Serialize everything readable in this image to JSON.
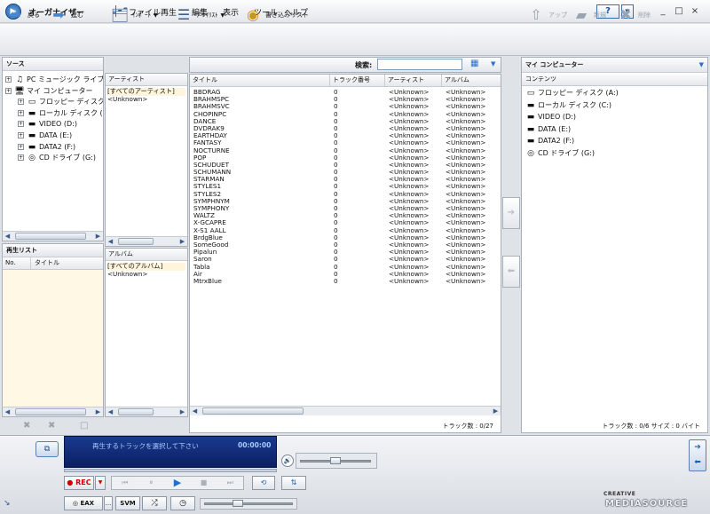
{
  "app": {
    "title": "オーガナイザー"
  },
  "menu": [
    "ファイル",
    "再生",
    "編集",
    "表示",
    "ツール",
    "ヘルプ"
  ],
  "window": {
    "help": "?",
    "min": "_",
    "max": "□",
    "close": "×"
  },
  "toolbar": {
    "back": "戻る",
    "forward": "進む",
    "import": "ｲﾝﾎﾟｰﾄ",
    "playlist": "ﾌﾟﾚｲﾘｽﾄ",
    "burn": "書き込みリスト",
    "up": "アップ",
    "new": "新規",
    "delete": "削除"
  },
  "source": {
    "header": "ソース",
    "items": [
      {
        "label": "PC ミュージック ライブラリ",
        "indent": 0,
        "icon": "music-library-icon",
        "glyph": "♫"
      },
      {
        "label": "マイ コンピューター",
        "indent": 0,
        "icon": "computer-icon",
        "glyph": "🖥"
      },
      {
        "label": "フロッピー ディスク (A:)",
        "indent": 1,
        "icon": "floppy-icon",
        "glyph": "▭"
      },
      {
        "label": "ローカル ディスク (C:)",
        "indent": 1,
        "icon": "drive-icon",
        "glyph": "▬"
      },
      {
        "label": "VIDEO (D:)",
        "indent": 1,
        "icon": "drive-icon",
        "glyph": "▬"
      },
      {
        "label": "DATA (E:)",
        "indent": 1,
        "icon": "drive-icon",
        "glyph": "▬"
      },
      {
        "label": "DATA2 (F:)",
        "indent": 1,
        "icon": "drive-icon",
        "glyph": "▬"
      },
      {
        "label": "CD ドライブ (G:)",
        "indent": 1,
        "icon": "cd-icon",
        "glyph": "◎"
      }
    ]
  },
  "playlist_panel": {
    "header": "再生リスト",
    "col_no": "No.",
    "col_title": "タイトル"
  },
  "artist_panel": {
    "header": "アーティスト",
    "items": [
      "[すべてのアーティスト]",
      "<Unknown>"
    ]
  },
  "album_panel": {
    "header": "アルバム",
    "items": [
      "[すべてのアルバム]",
      "<Unknown>"
    ]
  },
  "search": {
    "label": "検索:",
    "placeholder": ""
  },
  "tracks": {
    "columns": [
      "タイトル",
      "トラック番号",
      "アーティスト",
      "アルバム"
    ],
    "rows": [
      [
        "BBDRAG",
        "0",
        "<Unknown>",
        "<Unknown>"
      ],
      [
        "BRAHMSPC",
        "0",
        "<Unknown>",
        "<Unknown>"
      ],
      [
        "BRAHMSVC",
        "0",
        "<Unknown>",
        "<Unknown>"
      ],
      [
        "CHOPINPC",
        "0",
        "<Unknown>",
        "<Unknown>"
      ],
      [
        "DANCE",
        "0",
        "<Unknown>",
        "<Unknown>"
      ],
      [
        "DVDRAK9",
        "0",
        "<Unknown>",
        "<Unknown>"
      ],
      [
        "EARTHDAY",
        "0",
        "<Unknown>",
        "<Unknown>"
      ],
      [
        "FANTASY",
        "0",
        "<Unknown>",
        "<Unknown>"
      ],
      [
        "NOCTURNE",
        "0",
        "<Unknown>",
        "<Unknown>"
      ],
      [
        "POP",
        "0",
        "<Unknown>",
        "<Unknown>"
      ],
      [
        "SCHUDUET",
        "0",
        "<Unknown>",
        "<Unknown>"
      ],
      [
        "SCHUMANN",
        "0",
        "<Unknown>",
        "<Unknown>"
      ],
      [
        "STARMAN",
        "0",
        "<Unknown>",
        "<Unknown>"
      ],
      [
        "STYLES1",
        "0",
        "<Unknown>",
        "<Unknown>"
      ],
      [
        "STYLES2",
        "0",
        "<Unknown>",
        "<Unknown>"
      ],
      [
        "SYMPHNYM",
        "0",
        "<Unknown>",
        "<Unknown>"
      ],
      [
        "SYMPHONY",
        "0",
        "<Unknown>",
        "<Unknown>"
      ],
      [
        "WALTZ",
        "0",
        "<Unknown>",
        "<Unknown>"
      ],
      [
        "X-GCAPRE",
        "0",
        "<Unknown>",
        "<Unknown>"
      ],
      [
        "X-S1 AALL",
        "0",
        "<Unknown>",
        "<Unknown>"
      ],
      [
        "BrdgBlue",
        "0",
        "<Unknown>",
        "<Unknown>"
      ],
      [
        "SomeGood",
        "0",
        "<Unknown>",
        "<Unknown>"
      ],
      [
        "Pipalun",
        "0",
        "<Unknown>",
        "<Unknown>"
      ],
      [
        "Saron",
        "0",
        "<Unknown>",
        "<Unknown>"
      ],
      [
        "Tabla",
        "0",
        "<Unknown>",
        "<Unknown>"
      ],
      [
        "Air",
        "0",
        "<Unknown>",
        "<Unknown>"
      ],
      [
        "MtrxBlue",
        "0",
        "<Unknown>",
        "<Unknown>"
      ]
    ],
    "count": "トラック数 : 0/27"
  },
  "mycomputer": {
    "header": "マイ コンピューター",
    "col": "コンテンツ",
    "items": [
      {
        "label": "フロッピー ディスク (A:)",
        "icon": "floppy-icon",
        "glyph": "▭"
      },
      {
        "label": "ローカル ディスク (C:)",
        "icon": "drive-icon",
        "glyph": "▬"
      },
      {
        "label": "VIDEO (D:)",
        "icon": "drive-icon",
        "glyph": "▬"
      },
      {
        "label": "DATA (E:)",
        "icon": "drive-icon",
        "glyph": "▬"
      },
      {
        "label": "DATA2 (F:)",
        "icon": "drive-icon",
        "glyph": "▬"
      },
      {
        "label": "CD ドライブ (G:)",
        "icon": "cd-icon",
        "glyph": "◎"
      }
    ],
    "status": "トラック数 : 0/6  サイズ : 0 バイト"
  },
  "player": {
    "lcd_text": "再生するトラックを選択して下さい",
    "time": "00:00:00",
    "rec": "REC",
    "eax": "EAX",
    "eax_more": "...",
    "svm": "SVM"
  },
  "brand": {
    "top": "CREATIVE",
    "main": "MEDIASOURCE"
  }
}
